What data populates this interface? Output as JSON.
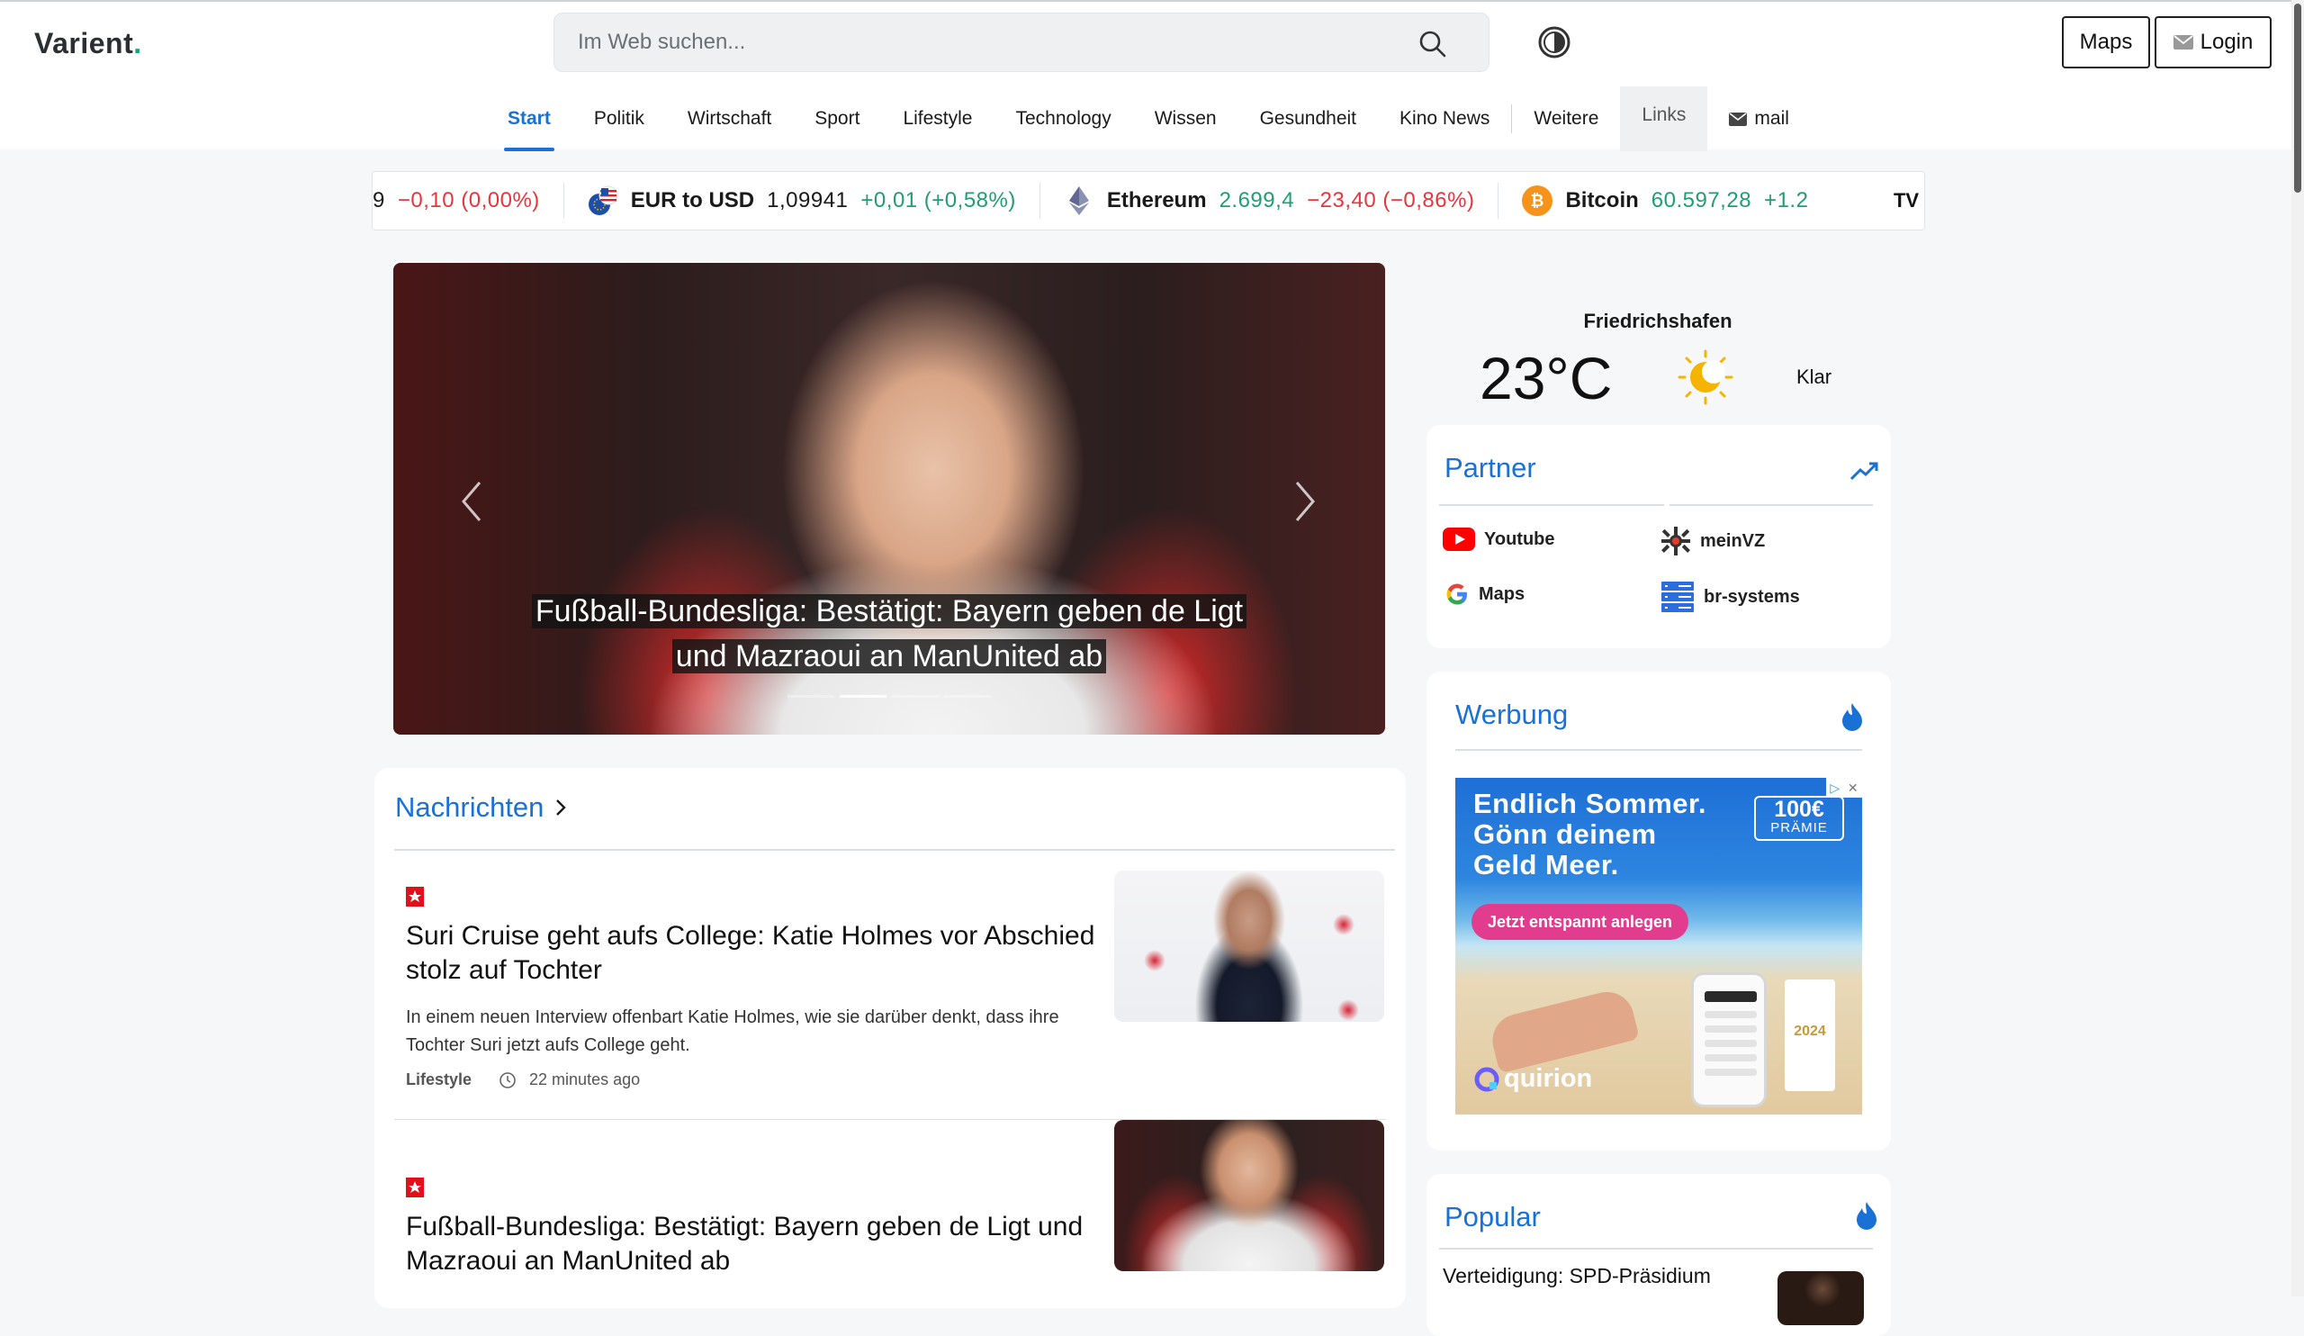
{
  "header": {
    "logo": "Varient",
    "logo_dot": ".",
    "search_placeholder": "Im Web suchen...",
    "maps_button": "Maps",
    "login_button": "Login"
  },
  "nav": [
    {
      "label": "Start",
      "active": true
    },
    {
      "label": "Politik"
    },
    {
      "label": "Wirtschaft"
    },
    {
      "label": "Sport"
    },
    {
      "label": "Lifestyle"
    },
    {
      "label": "Technology"
    },
    {
      "label": "Wissen"
    },
    {
      "label": "Gesundheit"
    },
    {
      "label": "Kino News"
    },
    {
      "label": "Weitere"
    },
    {
      "label": "Links"
    },
    {
      "label": "mail"
    }
  ],
  "ticker": {
    "partial_value": "9",
    "partial_change": "−0,10 (0,00%)",
    "items": [
      {
        "name": "EUR to USD",
        "value": "1,09941",
        "change": "+0,01 (+0,58%)"
      },
      {
        "name": "Ethereum",
        "value": "2.699,4",
        "change": "−23,40 (−0,86%)"
      },
      {
        "name": "Bitcoin",
        "value": "60.597,28",
        "change": "+1.2"
      }
    ],
    "logo": "TV"
  },
  "hero": {
    "caption_line1": "Fußball-Bundesliga: Bestätigt: Bayern geben de Ligt",
    "caption_line2": "und Mazraoui an ManUnited ab"
  },
  "news": {
    "title": "Nachrichten",
    "articles": [
      {
        "title": "Suri Cruise geht aufs College: Katie Holmes vor Abschied stolz auf Tochter",
        "description": "In einem neuen Interview offenbart Katie Holmes, wie sie darüber denkt, dass ihre Tochter Suri jetzt aufs College geht.",
        "category": "Lifestyle",
        "time": "22 minutes ago"
      },
      {
        "title": "Fußball-Bundesliga: Bestätigt: Bayern geben de Ligt und Mazraoui an ManUnited ab"
      }
    ]
  },
  "weather": {
    "city": "Friedrichshafen",
    "temperature": "23°C",
    "condition": "Klar"
  },
  "partner": {
    "title": "Partner",
    "links": [
      "Youtube",
      "meinVZ",
      "Maps",
      "br-systems"
    ]
  },
  "werbung": {
    "title": "Werbung",
    "ad_line1": "Endlich Sommer.",
    "ad_line2": "Gönn deinem",
    "ad_line3": "Geld Meer.",
    "ad_button": "Jetzt entspannt anlegen",
    "ad_badge_amount": "100€",
    "ad_badge_label": "PRÄMIE",
    "ad_brand": "quirion",
    "ad_award_year": "2024"
  },
  "popular": {
    "title": "Popular",
    "item": "Verteidigung: SPD-Präsidium"
  },
  "colors": {
    "accent": "#1971d6",
    "positive": "#1f9e74",
    "negative": "#e5363b"
  }
}
